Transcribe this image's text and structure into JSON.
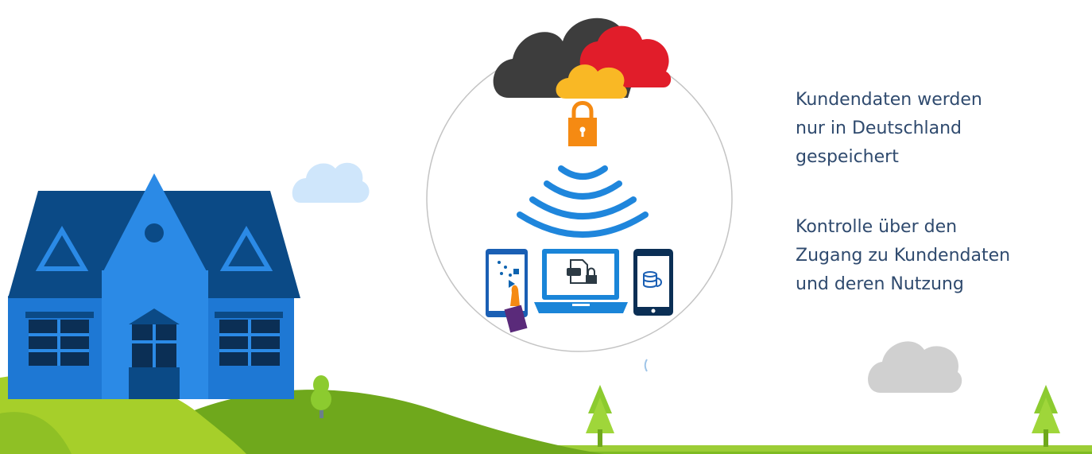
{
  "info": {
    "paragraphs": [
      {
        "lines": [
          "Kundendaten werden",
          "nur in Deutschland",
          "gespeichert"
        ]
      },
      {
        "lines": [
          "Kontrolle über den",
          "Zugang zu Kundendaten",
          "und deren Nutzung"
        ]
      }
    ]
  },
  "colors": {
    "house_roof": "#0b4a86",
    "house_wall": "#1e78d4",
    "house_wall_light": "#2b8ae6",
    "cloud_dark": "#3d3d3d",
    "cloud_red": "#e11d2a",
    "cloud_gold": "#f9b825",
    "lock": "#f58a12",
    "wifi": "#1f86dc",
    "hill_light": "#a6cf2a",
    "hill_dark": "#6fa81c",
    "tree": "#8ccb2f",
    "cloud_light_blue": "#cfe6fb",
    "cloud_grey": "#d0d0d0",
    "text": "#2f4a6e"
  },
  "icons": [
    "house-icon",
    "cloud-icon",
    "lock-icon",
    "wifi-icon",
    "tablet-icon",
    "laptop-icon",
    "phone-icon",
    "tree-icon"
  ]
}
